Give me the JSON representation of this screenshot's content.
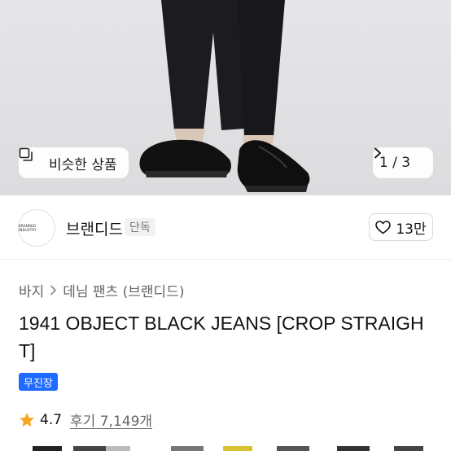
{
  "hero": {
    "similar_label": "비슷한 상품",
    "pager_text": "1 / 3"
  },
  "brand": {
    "logo_text": "BRANDED INDUSTRY",
    "name": "브랜디드",
    "badge": "단독",
    "like_count": "13만"
  },
  "breadcrumb": {
    "items": [
      "바지",
      "데님 팬츠 (브랜디드)"
    ]
  },
  "product": {
    "title": "1941 OBJECT BLACK JEANS [CROP STRAIGHT]",
    "shipping_badge": "무진장",
    "rating": "4.7",
    "reviews": "후기 7,149개"
  },
  "colors": {
    "accent_blue": "#1f6bff",
    "star": "#f5a623"
  },
  "icons": {
    "similar": "similar-products-icon",
    "pager_next": "chevron-right-icon",
    "like": "heart-icon",
    "breadcrumb_sep": "chevron-right-icon",
    "star": "star-icon"
  }
}
